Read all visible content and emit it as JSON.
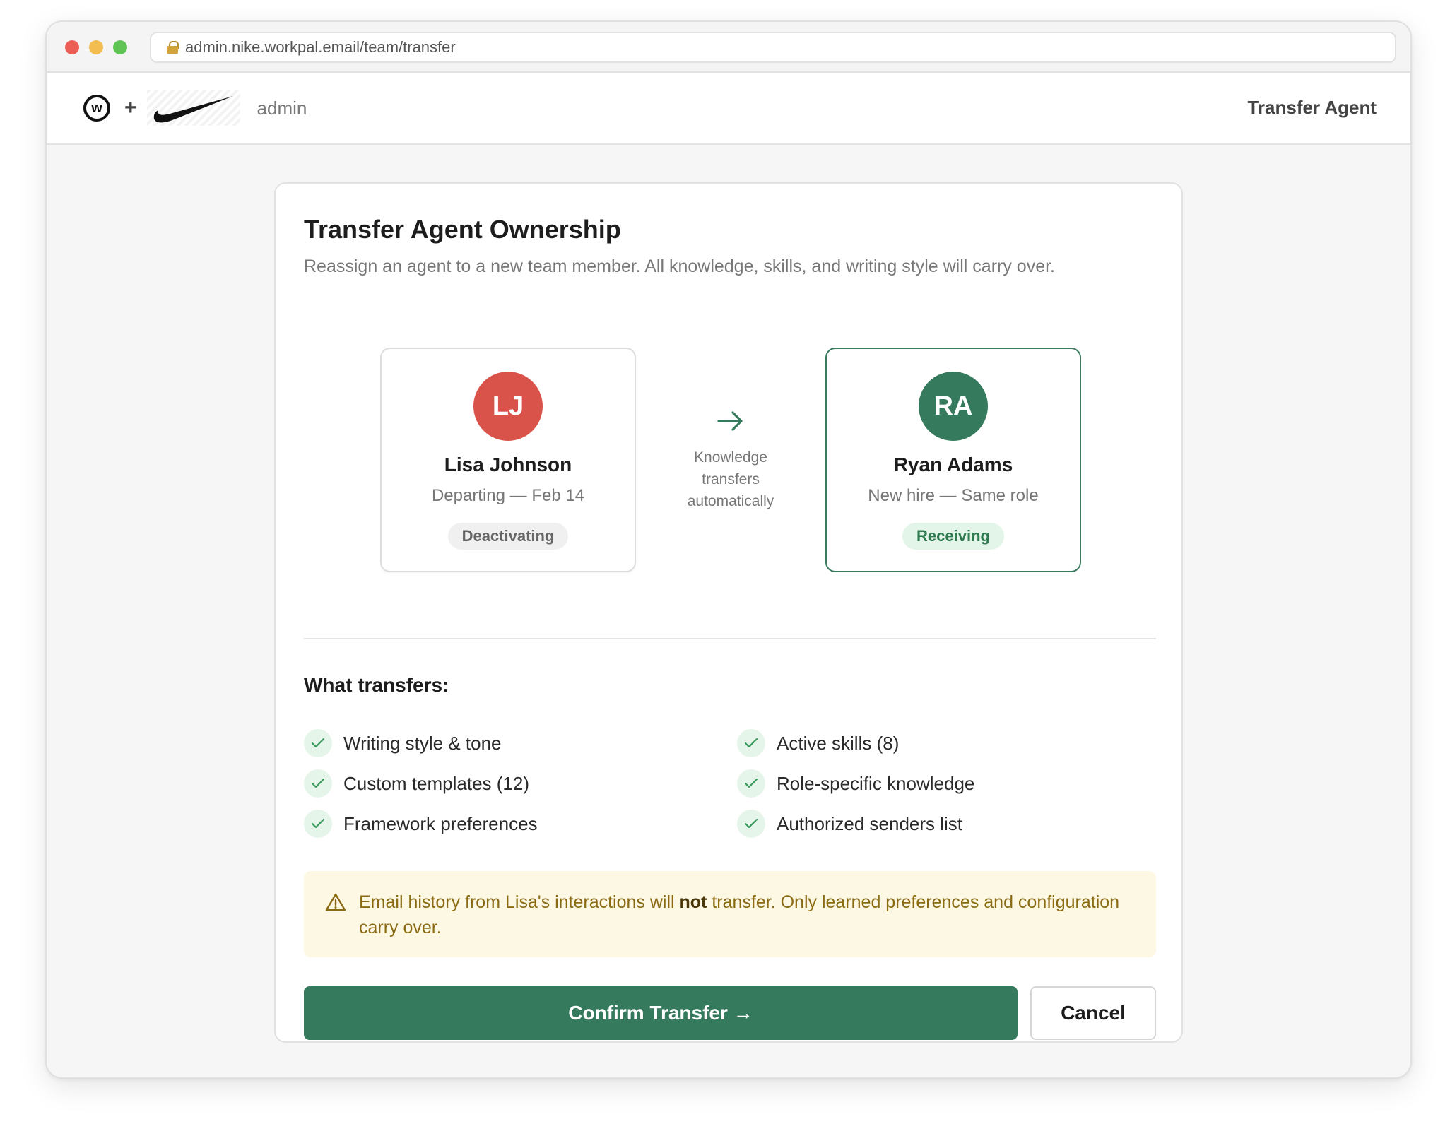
{
  "browser": {
    "url": "admin.nike.workpal.email/team/transfer"
  },
  "header": {
    "logo_letter": "w",
    "plus": "+",
    "admin_label": "admin",
    "title": "Transfer Agent"
  },
  "card": {
    "title": "Transfer Agent Ownership",
    "subtitle": "Reassign an agent to a new team member. All knowledge, skills, and writing style will carry over."
  },
  "from_person": {
    "initials": "LJ",
    "name": "Lisa Johnson",
    "detail": "Departing — Feb 14",
    "status": "Deactivating",
    "avatar_color": "#d9534a"
  },
  "to_person": {
    "initials": "RA",
    "name": "Ryan Adams",
    "detail": "New hire — Same role",
    "status": "Receiving",
    "avatar_color": "#357a5d"
  },
  "transfer_note": {
    "line1": "Knowledge",
    "line2": "transfers",
    "line3": "automatically"
  },
  "transfers": {
    "heading": "What transfers:",
    "items": [
      "Writing style & tone",
      "Active skills (8)",
      "Custom templates (12)",
      "Role-specific knowledge",
      "Framework preferences",
      "Authorized senders list"
    ]
  },
  "warning": {
    "pre": "Email history from Lisa's interactions will ",
    "bold": "not",
    "post": " transfer. Only learned preferences and configuration carry over."
  },
  "actions": {
    "confirm_label": "Confirm Transfer →",
    "cancel_label": "Cancel"
  },
  "colors": {
    "accent": "#357a5d",
    "danger": "#d9534a",
    "warning_bg": "#fdf8e4",
    "warning_text": "#8a6a12"
  }
}
